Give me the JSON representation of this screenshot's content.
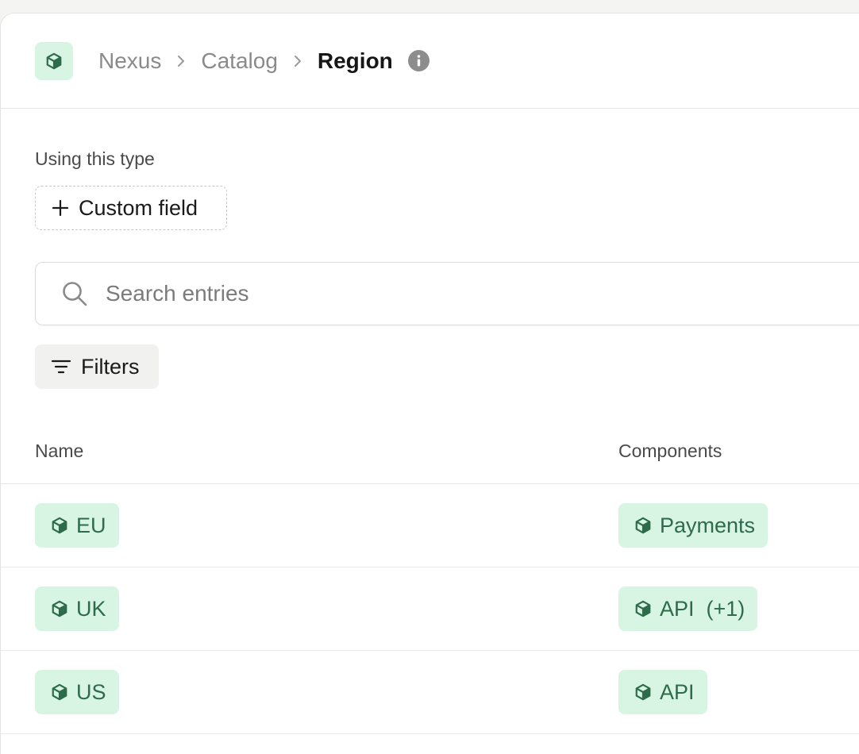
{
  "breadcrumb": {
    "items": [
      "Nexus",
      "Catalog"
    ],
    "current": "Region"
  },
  "using_label": "Using this type",
  "custom_field_label": "Custom field",
  "search": {
    "placeholder": "Search entries",
    "value": ""
  },
  "filters_label": "Filters",
  "table": {
    "columns": [
      "Name",
      "Components"
    ],
    "rows": [
      {
        "name": "EU",
        "component": "Payments"
      },
      {
        "name": "UK",
        "component": "API  (+1)"
      },
      {
        "name": "US",
        "component": "API"
      }
    ]
  },
  "colors": {
    "accent_bg": "#d8f5e3",
    "accent_fg": "#2d6b4b"
  },
  "icons": {
    "logo": "cube-icon",
    "separator": "chevron-right-icon",
    "info": "info-icon",
    "add": "plus-icon",
    "search": "search-icon",
    "filter": "filter-icon"
  }
}
